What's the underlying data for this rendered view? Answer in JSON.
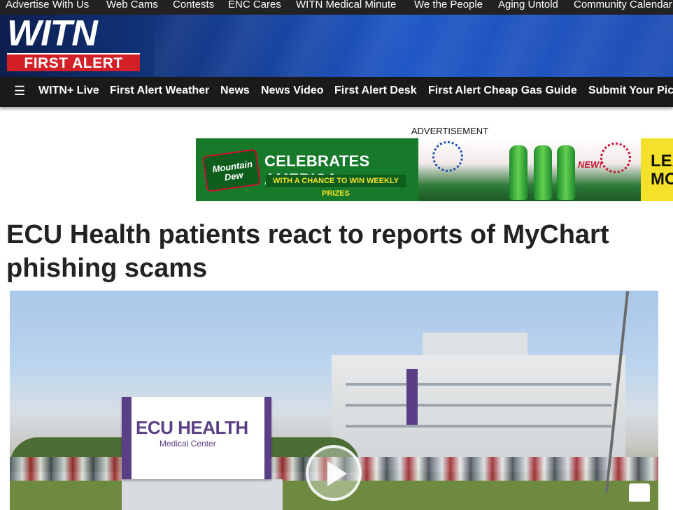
{
  "topbar": {
    "links": [
      "Advertise With Us",
      "Web Cams",
      "Contests",
      "ENC Cares",
      "WITN Medical Minute",
      "We the People",
      "Aging Untold",
      "Community Calendar"
    ]
  },
  "brand": {
    "name": "WITN",
    "tagline": "FIRST ALERT",
    "accent_color": "#d31f26",
    "header_color": "#1f57c6"
  },
  "nav": {
    "menu_icon": "☰",
    "items": [
      "WITN+ Live",
      "First Alert Weather",
      "News",
      "News Video",
      "First Alert Desk",
      "First Alert Cheap Gas Guide",
      "Submit Your Pics"
    ]
  },
  "ad": {
    "label": "ADVERTISEMENT",
    "brand": "Mountain Dew",
    "headline": "CELEBRATES AMERICA",
    "subline": "WITH A CHANCE TO WIN WEEKLY PRIZES",
    "badge": "NEW!",
    "cta": "LEARN MORE"
  },
  "article": {
    "headline": "ECU Health patients react to reports of MyChart phishing scams"
  },
  "video": {
    "sign_brand": "ECU HEALTH",
    "sign_subtitle": "Medical Center",
    "play_icon": "play-icon"
  }
}
